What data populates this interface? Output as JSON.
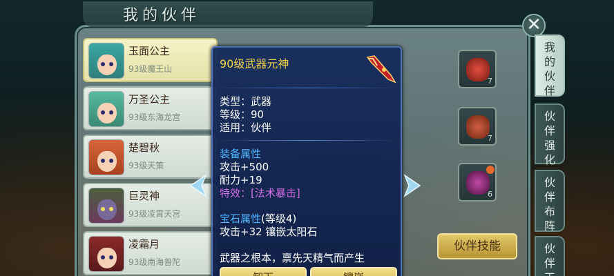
{
  "window": {
    "title": "我的伙伴",
    "close_symbol": "✕"
  },
  "partners": [
    {
      "name": "玉面公主",
      "sub": "93级魔王山",
      "hair": "#3aa7a3",
      "selected": true
    },
    {
      "name": "万圣公主",
      "sub": "93级东海龙宫",
      "hair": "#58b9a0",
      "selected": false
    },
    {
      "name": "楚碧秋",
      "sub": "93级天策",
      "hair": "#d9653a",
      "selected": false
    },
    {
      "name": "巨灵神",
      "sub": "93级凌霄天宫",
      "hair": "#4c5f3f",
      "selected": false
    },
    {
      "name": "凌霜月",
      "sub": "93级南海普陀",
      "hair": "#8a2a2a",
      "selected": false
    }
  ],
  "tooltip": {
    "title": "90级武器元神",
    "type_line": "类型：武器",
    "level_line": "等级：90",
    "use_line": "适用：伙伴",
    "equip_header": "装备属性",
    "attack_line": "攻击+500",
    "durability_line": "耐力+19",
    "special_line": "特效：[法术暴击]",
    "gem_header": "宝石属性",
    "gem_level": "(等级4)",
    "gem_line": "攻击+32 镶嵌太阳石",
    "flavor": "武器之根本，禀先天精气而产生",
    "btn_left": "卸下",
    "btn_right": "镶嵌"
  },
  "slots": [
    {
      "count": "7",
      "color": "#b8342c"
    },
    {
      "count": "7",
      "color": "#a8452f"
    },
    {
      "count": "6",
      "color": "#a0268e"
    }
  ],
  "partner_skill": "伙伴技能",
  "side_tabs": [
    {
      "label": "我的伙伴",
      "active": true
    },
    {
      "label": "伙伴强化",
      "active": false
    },
    {
      "label": "伙伴布阵",
      "active": false
    },
    {
      "label": "伙伴天",
      "active": false
    }
  ],
  "colors": {
    "tooltip_title": "#f3d54a",
    "section_header": "#4fb4ff",
    "special_effect": "#d26ee6"
  },
  "icons": [
    "close-icon",
    "left-arrow-icon",
    "right-arrow-icon",
    "weapon-icon"
  ]
}
